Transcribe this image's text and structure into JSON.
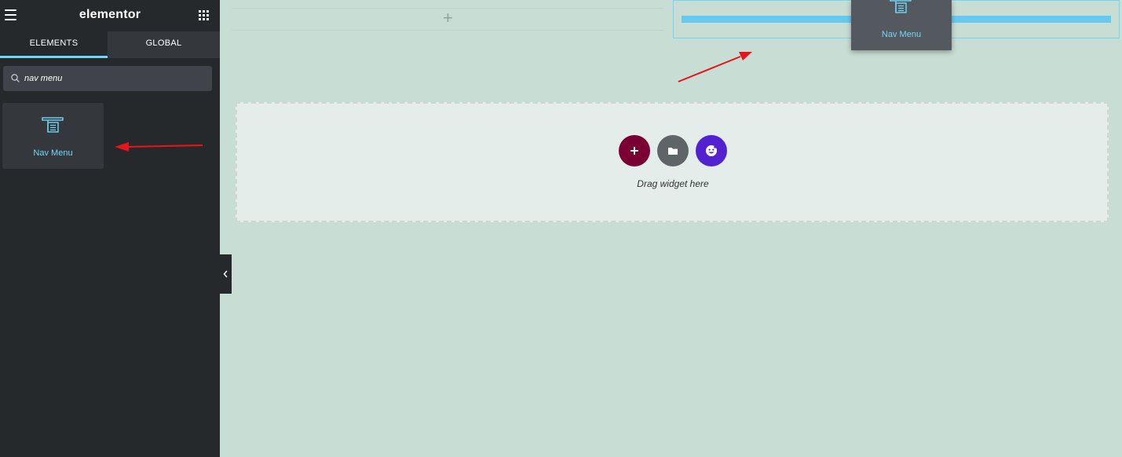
{
  "sidebar": {
    "brand": "elementor",
    "tabs": [
      {
        "label": "ELEMENTS",
        "active": true
      },
      {
        "label": "GLOBAL",
        "active": false
      }
    ],
    "search": {
      "value": "nav menu"
    },
    "widget": {
      "label": "Nav Menu",
      "icon": "nav-menu-icon"
    }
  },
  "canvas": {
    "drag_ghost_label": "Nav Menu",
    "empty_section_text": "Drag widget here",
    "buttons": {
      "add": {
        "icon": "plus-icon",
        "color": "#7a0034"
      },
      "template": {
        "icon": "folder-icon",
        "color": "#5f6469"
      },
      "kit": {
        "icon": "smiley-icon",
        "color": "#5222d0"
      }
    }
  },
  "colors": {
    "accent": "#71d7f7",
    "sidebar_bg": "#26292c",
    "canvas_bg": "#c8ddd4",
    "annotation_arrow": "#e8141b"
  }
}
